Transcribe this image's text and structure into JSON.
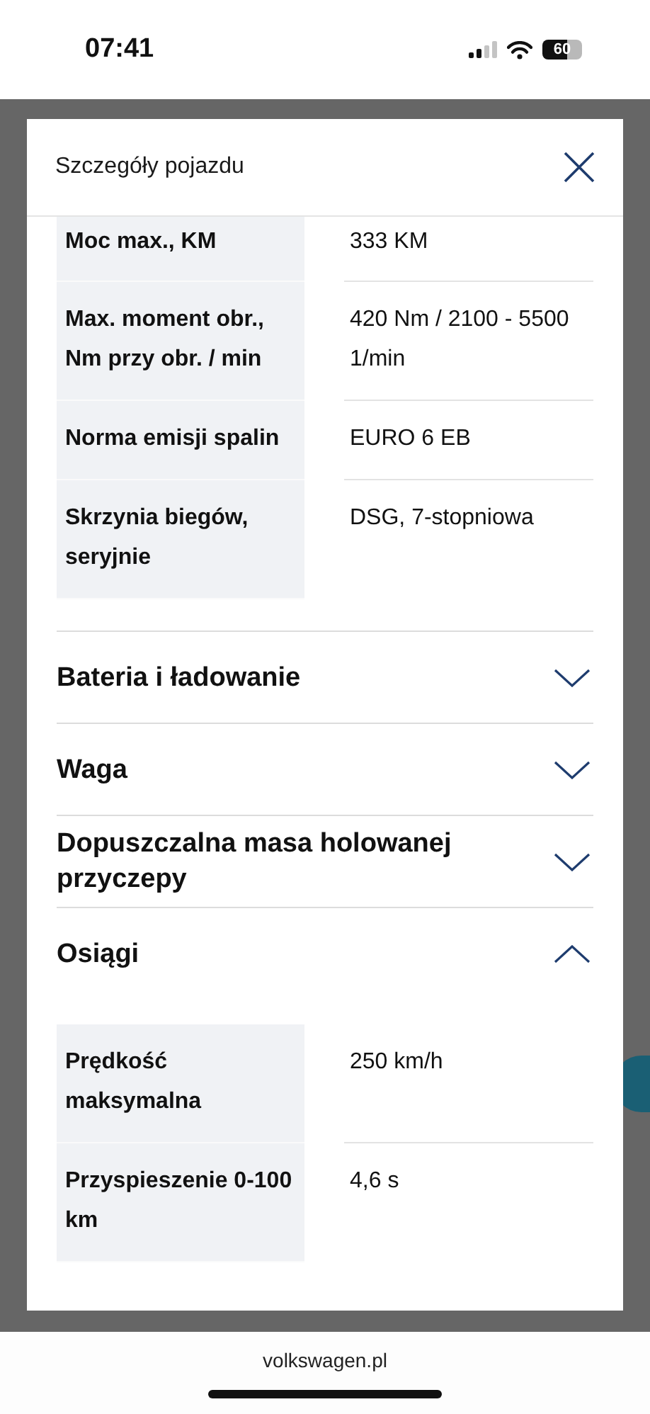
{
  "status_bar": {
    "time": "07:41",
    "battery": "60"
  },
  "modal": {
    "title": "Szczegóły pojazdu",
    "rows": [
      {
        "label": "Moc max., KM",
        "value": "333 KM"
      },
      {
        "label": "Max. moment obr., Nm przy obr. / min",
        "value": "420 Nm / 2100 - 5500 1/min"
      },
      {
        "label": "Norma emisji spalin",
        "value": "EURO 6 EB"
      },
      {
        "label": "Skrzynia biegów, seryjnie",
        "value": "DSG, 7-stopniowa"
      }
    ],
    "sections": [
      {
        "title": "Bateria i ładowanie",
        "expanded": false
      },
      {
        "title": "Waga",
        "expanded": false
      },
      {
        "title": "Dopuszczalna masa holowanej przyczepy",
        "expanded": false
      },
      {
        "title": "Osiągi",
        "expanded": true,
        "rows": [
          {
            "label": "Prędkość maksymalna",
            "value": "250 km/h"
          },
          {
            "label": "Przyspieszenie 0-100 km",
            "value": "4,6 s"
          }
        ]
      }
    ]
  },
  "browser_bar": {
    "url": "volkswagen.pl"
  }
}
